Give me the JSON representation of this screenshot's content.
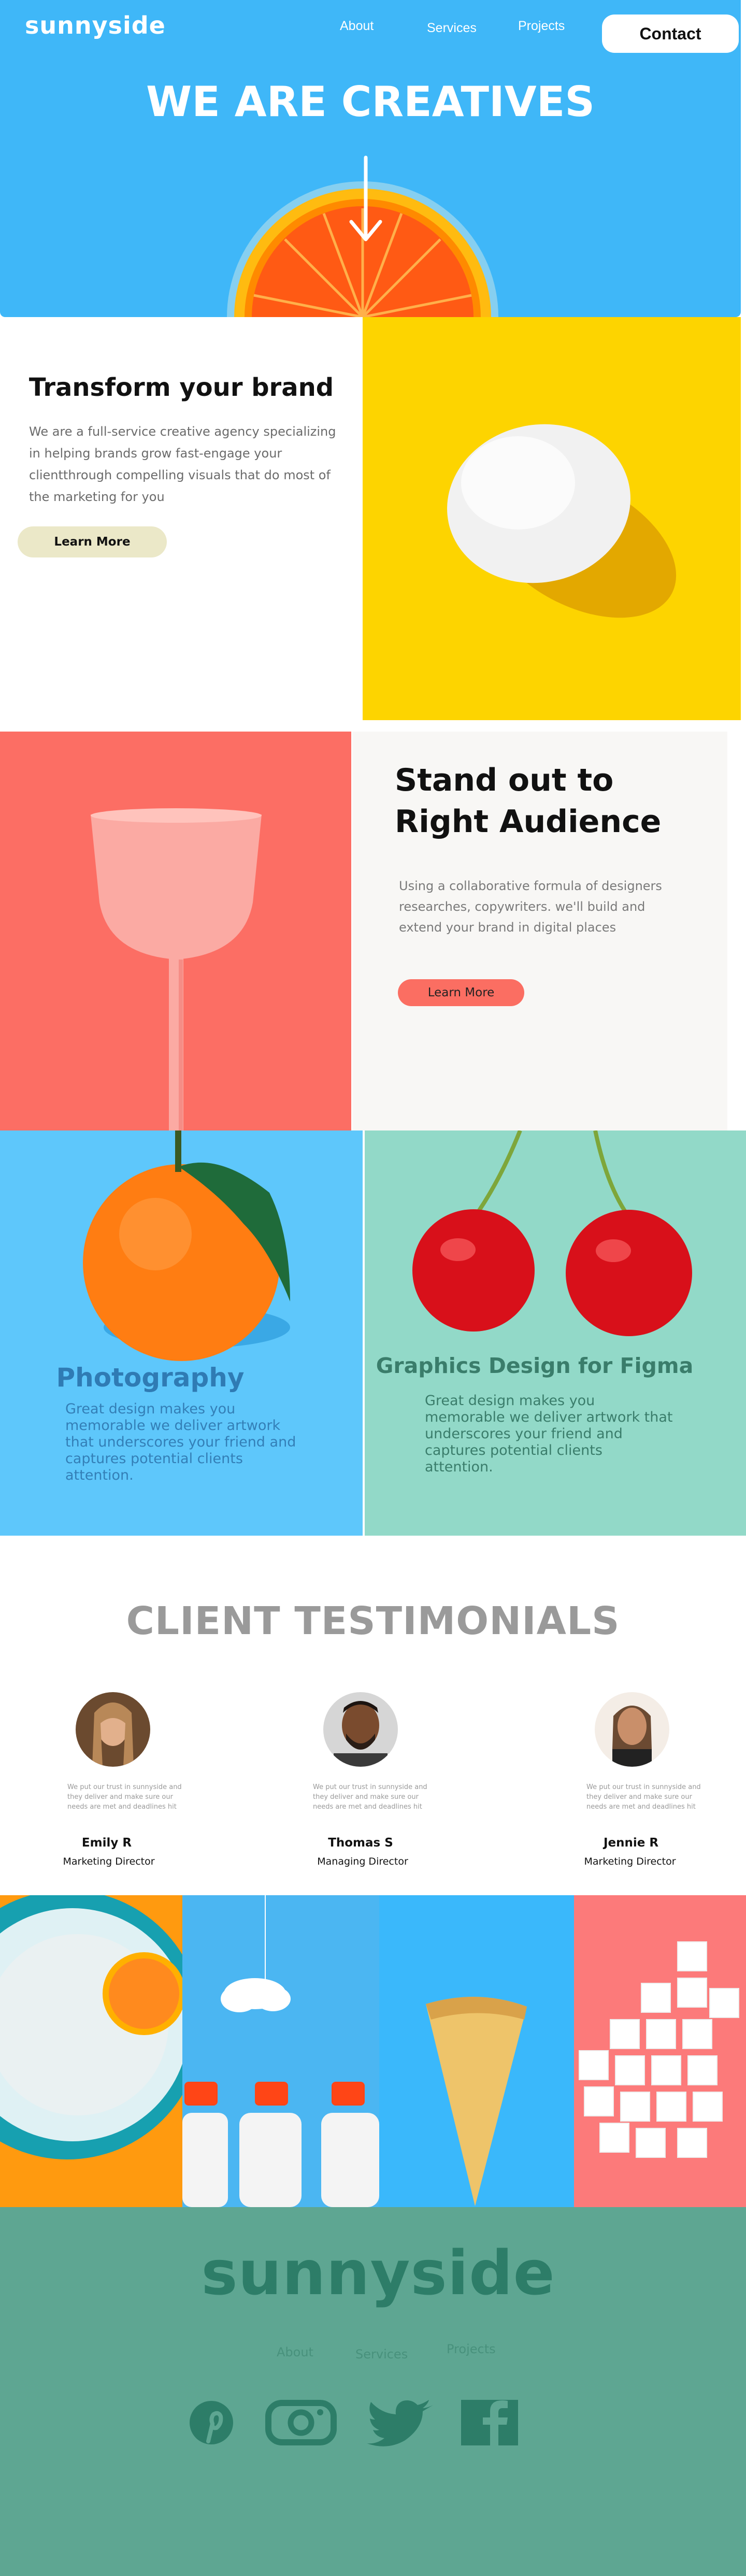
{
  "header": {
    "logo": "sunnyside",
    "nav": [
      "About",
      "Services",
      "Projects"
    ],
    "contact_label": "Contact"
  },
  "hero": {
    "title": "WE ARE CREATIVES",
    "arrow_icon": "arrow-down-icon"
  },
  "transform": {
    "title": "Transform your brand",
    "body": "We are a full-service creative agency specializing in helping brands grow fast-engage your clientthrough compelling visuals that do most of the marketing for you",
    "button": "Learn More"
  },
  "standout": {
    "title": "Stand out to Right Audience",
    "body": "Using a collaborative formula of designers researches, copywriters. we'll build and extend your brand in digital places",
    "button": "Learn More"
  },
  "services": [
    {
      "title": "Photography",
      "body": "Great design makes you memorable we deliver artwork that underscores your friend and captures potential clients attention."
    },
    {
      "title": "Graphics Design for Figma",
      "body": "Great design makes you memorable we deliver artwork that underscores your friend and captures potential clients attention."
    }
  ],
  "testimonials": {
    "title": "CLIENT TESTIMONIALS",
    "items": [
      {
        "quote": "We put our trust in sunnyside and they deliver and make sure our needs are met and deadlines hit",
        "name": "Emily R",
        "role": "Marketing Director"
      },
      {
        "quote": "We put our trust in sunnyside and they deliver and make sure our needs are met and deadlines hit",
        "name": "Thomas S",
        "role": "Managing Director"
      },
      {
        "quote": "We put our trust in sunnyside and they deliver and make sure our needs are met and deadlines hit",
        "name": "Jennie R",
        "role": "Marketing Director"
      }
    ]
  },
  "footer": {
    "logo": "sunnyside",
    "nav": [
      "About",
      "Services",
      "Projects"
    ],
    "social": [
      "pinterest-icon",
      "instagram-icon",
      "twitter-icon",
      "facebook-icon"
    ]
  },
  "colors": {
    "hero_blue": "#3fb7f8",
    "yellow": "#fdd400",
    "coral": "#fc6e64",
    "sky": "#5ec7fb",
    "mint": "#92d9c8",
    "footer_green": "#5ea692"
  }
}
